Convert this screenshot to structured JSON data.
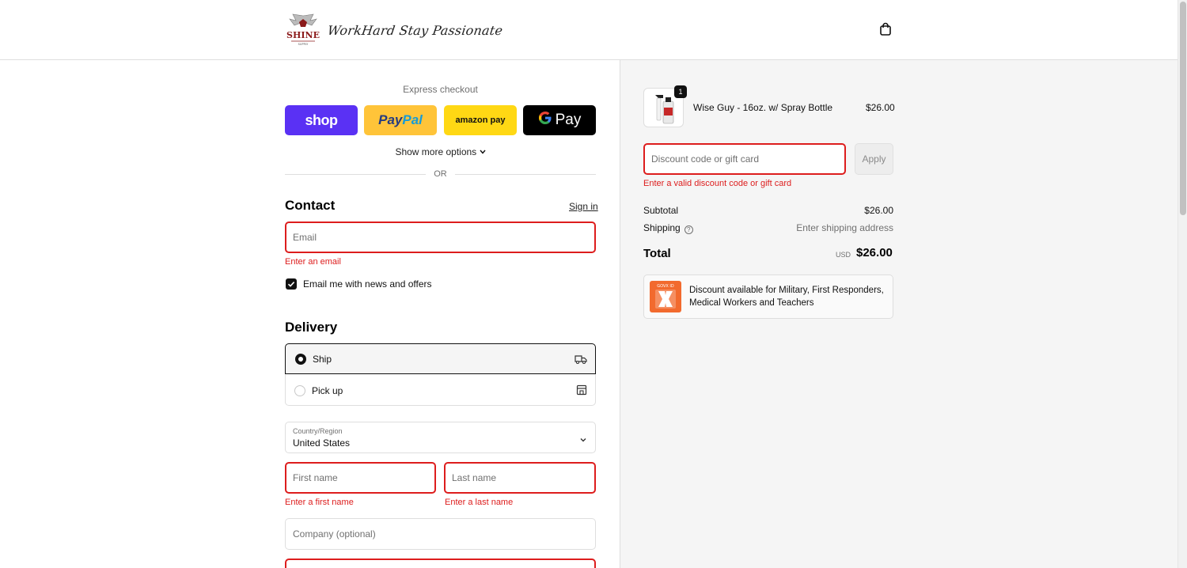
{
  "header": {
    "brand_script": "WorkHard Stay Passionate",
    "logo_word": "SHINE",
    "colors": {
      "brand_red": "#8b1a1a"
    }
  },
  "express": {
    "title": "Express checkout",
    "buttons": [
      {
        "label": "shop",
        "color": "#5a31f4"
      },
      {
        "label_a": "Pay",
        "label_b": "Pal",
        "color": "#ffc439"
      },
      {
        "label": "amazon pay",
        "color": "#ffd814"
      },
      {
        "g": "G",
        "label": "Pay",
        "color": "#000000"
      }
    ],
    "show_more": "Show more options",
    "or": "OR"
  },
  "contact": {
    "title": "Contact",
    "sign_in": "Sign in",
    "email_placeholder": "Email",
    "email_error": "Enter an email",
    "newsletter_label": "Email me with news and offers",
    "newsletter_checked": true
  },
  "delivery": {
    "title": "Delivery",
    "options": [
      {
        "label": "Ship",
        "selected": true
      },
      {
        "label": "Pick up",
        "selected": false
      }
    ],
    "country_label": "Country/Region",
    "country_value": "United States",
    "first_name_placeholder": "First name",
    "first_name_error": "Enter a first name",
    "last_name_placeholder": "Last name",
    "last_name_error": "Enter a last name",
    "company_placeholder": "Company (optional)"
  },
  "summary": {
    "item": {
      "name": "Wise Guy - 16oz. w/ Spray Bottle",
      "price": "$26.00",
      "qty": "1"
    },
    "discount_placeholder": "Discount code or gift card",
    "apply": "Apply",
    "discount_error": "Enter a valid discount code or gift card",
    "subtotal_label": "Subtotal",
    "subtotal_value": "$26.00",
    "shipping_label": "Shipping",
    "shipping_value": "Enter shipping address",
    "total_label": "Total",
    "currency": "USD",
    "total_value": "$26.00",
    "promo_text": "Discount available for Military, First Responders, Medical Workers and Teachers",
    "promo_logo_text": "GOVX ID"
  },
  "colors": {
    "error": "#dd1d1d",
    "summary_bg": "#f5f5f5"
  }
}
